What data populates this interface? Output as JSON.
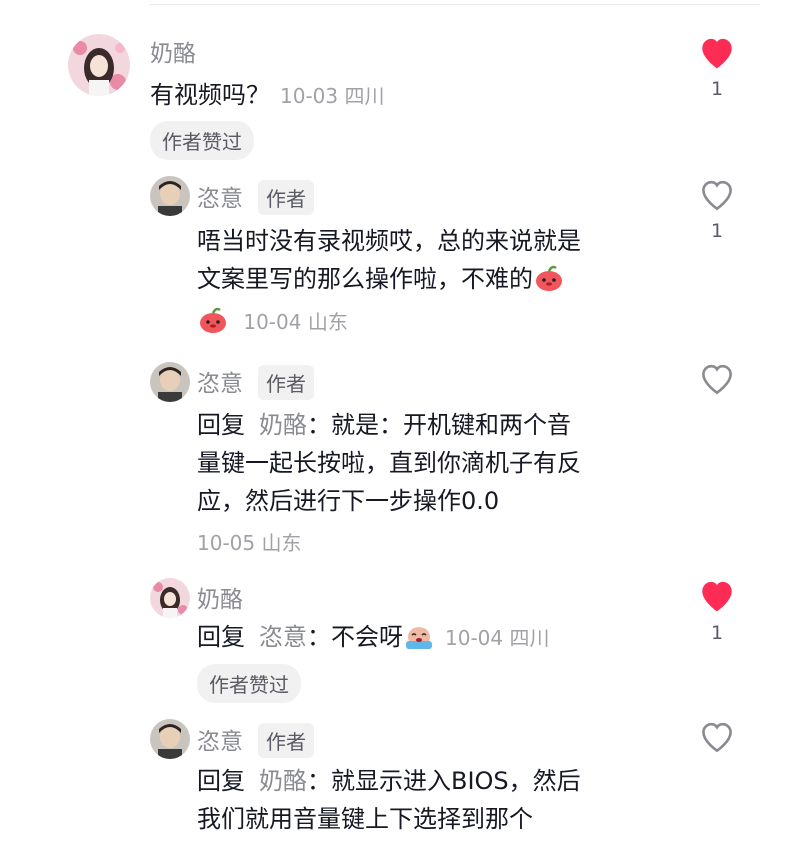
{
  "comments": {
    "c1": {
      "username": "奶酪",
      "text": "有视频吗？",
      "meta": "10-03 四川",
      "liked_by_author": "作者赞过",
      "likes": "1",
      "liked": true
    },
    "c2": {
      "username": "恣意",
      "author_tag": "作者",
      "text_line1": "唔当时没有录视频哎，总的来说就是",
      "text_line2": "文案里写的那么操作啦，不难的",
      "meta": "10-04 山东",
      "likes": "1",
      "liked": false
    },
    "c3": {
      "username": "恣意",
      "author_tag": "作者",
      "reply_word": "回复",
      "reply_target": "奶酪",
      "text_line1": "：就是：开机键和两个音",
      "text_line2": "量键一起长按啦，直到你滴机子有反",
      "text_line3": "应，然后进行下一步操作0.0",
      "meta": "10-05 山东",
      "liked": false
    },
    "c4": {
      "username": "奶酪",
      "reply_word": "回复",
      "reply_target": "恣意",
      "text": "：不会呀",
      "meta": "10-04 四川",
      "liked_by_author": "作者赞过",
      "likes": "1",
      "liked": true
    },
    "c5": {
      "username": "恣意",
      "author_tag": "作者",
      "reply_word": "回复",
      "reply_target": "奶酪",
      "text_line1": "：就显示进入BIOS，然后",
      "text_line2": "我们就用音量键上下选择到那个"
    }
  },
  "colors": {
    "like_red": "#fe2c55",
    "muted_text": "#8a8b91",
    "chip_bg": "#f1f1f2"
  },
  "icons": {
    "liked": "heart-filled-icon",
    "not_liked": "heart-outline-icon",
    "emoji_2": "red-blob-emoji",
    "emoji_4": "crying-emoji"
  }
}
